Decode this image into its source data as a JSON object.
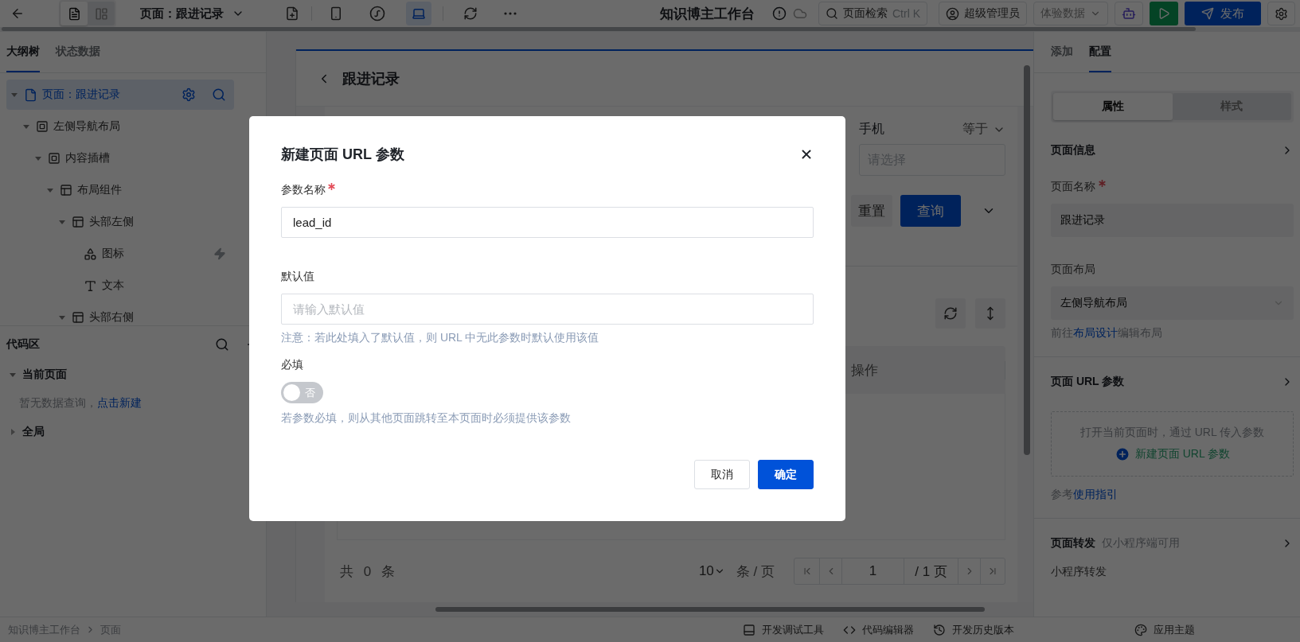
{
  "topbar": {
    "views": [
      {
        "kind": "outline",
        "selected": true
      },
      {
        "kind": "component",
        "selected": false
      }
    ],
    "page_selector": "页面：跟进记录",
    "devices": [
      {
        "kind": "mobile",
        "selected": false
      },
      {
        "kind": "miniprogram",
        "selected": false
      },
      {
        "kind": "desktop",
        "selected": true
      }
    ],
    "app_title": "知识博主工作台",
    "search": {
      "label": "页面检索",
      "shortcut": "Ctrl K"
    },
    "user": "超级管理员",
    "data_mode": "体验数据",
    "publish": "发布"
  },
  "left_panel": {
    "tabs": [
      {
        "label": "大纲树",
        "selected": true
      },
      {
        "label": "状态数据",
        "selected": false
      }
    ],
    "tree": [
      {
        "label": "页面：跟进记录",
        "kind": "page",
        "selected": true,
        "expanded": true,
        "children": [
          {
            "label": "左侧导航布局",
            "kind": "slot",
            "selected": false,
            "expanded": true,
            "children": [
              {
                "label": "内容插槽",
                "kind": "slot",
                "selected": false,
                "expanded": true,
                "children": [
                  {
                    "label": "布局组件",
                    "kind": "layout",
                    "selected": false,
                    "expanded": true,
                    "children": [
                      {
                        "label": "头部左侧",
                        "kind": "layout",
                        "selected": false,
                        "expanded": true,
                        "children": [
                          {
                            "label": "图标",
                            "kind": "icon",
                            "selected": false,
                            "event": true
                          },
                          {
                            "label": "文本",
                            "kind": "text",
                            "selected": false,
                            "event": false
                          }
                        ]
                      },
                      {
                        "label": "头部右侧",
                        "kind": "layout",
                        "selected": false,
                        "expanded": true
                      }
                    ]
                  }
                ]
              }
            ]
          }
        ]
      }
    ],
    "code_area": {
      "title": "代码区",
      "groups": [
        {
          "label": "当前页面",
          "expanded": true,
          "empty_text": "暂无数据查询，",
          "action": "点击新建"
        },
        {
          "label": "全局",
          "expanded": false
        }
      ]
    }
  },
  "canvas": {
    "page_title": "跟进记录",
    "filter": {
      "field_label": "手机",
      "operator": "等于",
      "placeholder": "请选择",
      "reset": "重置",
      "search": "查询"
    },
    "table": {
      "columns": [
        "操作"
      ]
    },
    "pagination": {
      "total": "共 0 条",
      "page_size": "10",
      "size_unit": "条 / 页",
      "page": "1",
      "page_count": "/ 1 页"
    }
  },
  "right_panel": {
    "tabs": [
      {
        "label": "添加",
        "selected": false
      },
      {
        "label": "配置",
        "selected": true
      }
    ],
    "segments": [
      {
        "label": "属性",
        "selected": true
      },
      {
        "label": "样式",
        "selected": false
      }
    ],
    "page_info": {
      "title": "页面信息",
      "fields": [
        {
          "kind": "input",
          "label": "页面名称",
          "required": true,
          "value": "跟进记录"
        },
        {
          "kind": "select",
          "label": "页面布局",
          "required": false,
          "value": "左侧导航布局",
          "help": {
            "before": "前往",
            "link": "布局设计",
            "after": "编辑布局"
          }
        }
      ]
    },
    "url_params": {
      "title": "页面 URL 参数",
      "empty_text": "打开当前页面时，通过 URL 传入参数",
      "add": "新建页面 URL 参数",
      "guide": {
        "before": "参考",
        "link": "使用指引"
      }
    },
    "forward": {
      "title": "页面转发",
      "note": "仅小程序端可用",
      "label": "小程序转发"
    }
  },
  "dialog": {
    "title": "新建页面 URL 参数",
    "fields": [
      {
        "kind": "text",
        "label": "参数名称",
        "required": true,
        "value": "lead_id"
      },
      {
        "kind": "text",
        "label": "默认值",
        "required": false,
        "placeholder": "请输入默认值",
        "help": "注意：若此处填入了默认值，则 URL 中无此参数时默认使用该值"
      },
      {
        "kind": "switch",
        "label": "必填",
        "required": false,
        "on": false,
        "switch_text": "否",
        "help": "若参数必填，则从其他页面跳转至本页面时必须提供该参数"
      }
    ],
    "buttons": [
      {
        "label": "取消",
        "primary": false
      },
      {
        "label": "确定",
        "primary": true
      }
    ]
  },
  "status_bar": {
    "breadcrumb": [
      "知识博主工作台",
      "页面"
    ],
    "tools": [
      {
        "kind": "debug",
        "label": "开发调试工具"
      },
      {
        "kind": "code",
        "label": "代码编辑器"
      },
      {
        "kind": "history",
        "label": "开发历史版本"
      },
      {
        "kind": "theme",
        "label": "应用主题"
      }
    ]
  }
}
